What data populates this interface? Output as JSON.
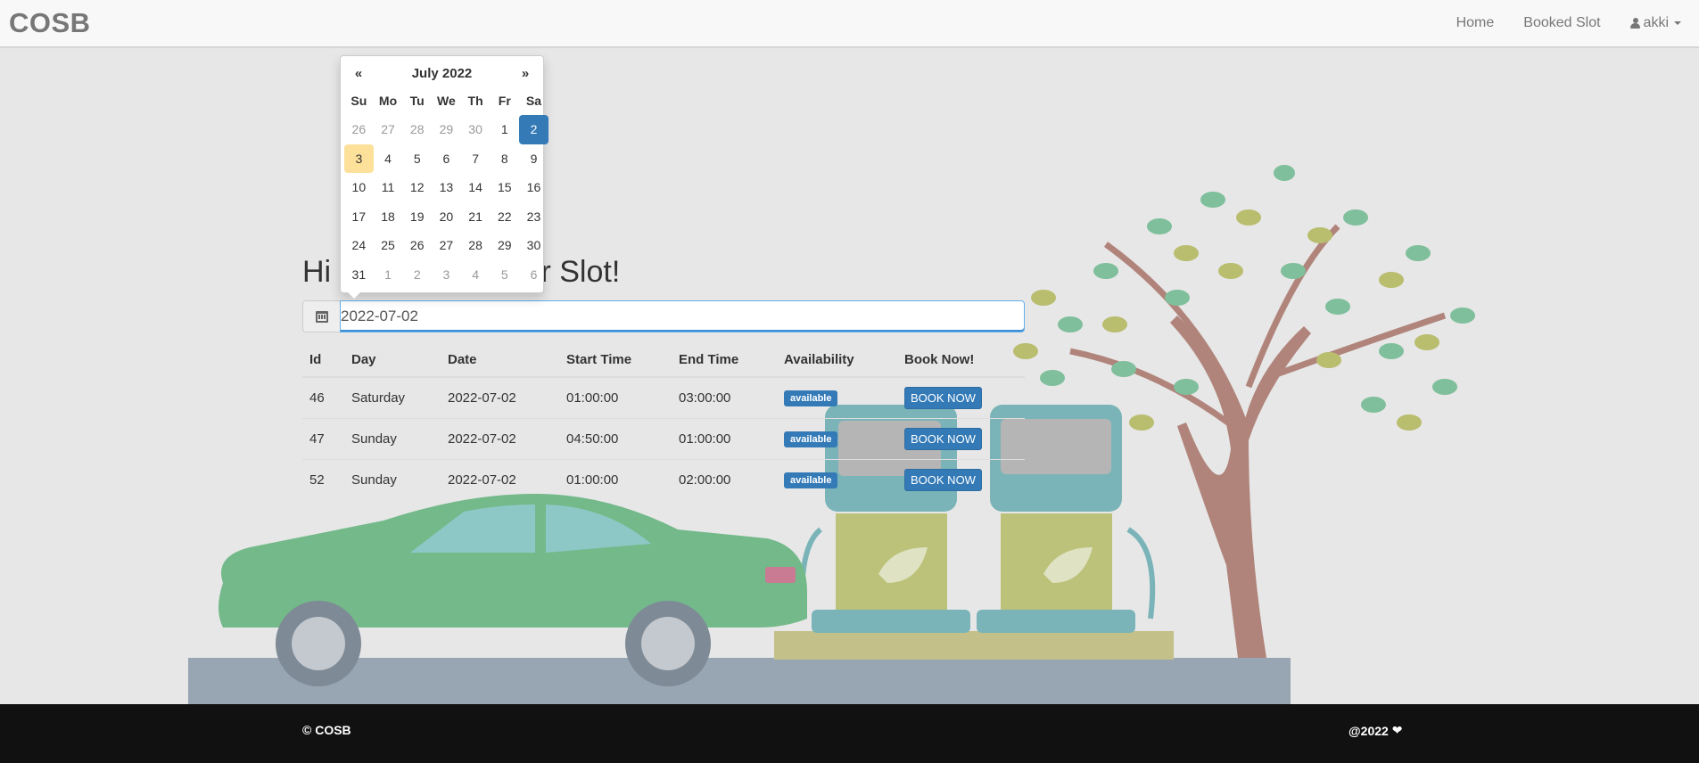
{
  "navbar": {
    "brand": "COSB",
    "links": [
      {
        "label": "Home"
      },
      {
        "label": "Booked Slot"
      }
    ],
    "user": {
      "label": "akki",
      "icon": "user-icon"
    }
  },
  "main": {
    "heading_left": "Hi a",
    "heading_right": "r Slot!",
    "date_input": {
      "value": "2022-07-02",
      "icon": "calendar-icon"
    }
  },
  "datepicker": {
    "prev": "«",
    "title": "July 2022",
    "next": "»",
    "dow": [
      "Su",
      "Mo",
      "Tu",
      "We",
      "Th",
      "Fr",
      "Sa"
    ],
    "days": [
      {
        "d": "26",
        "cls": "old"
      },
      {
        "d": "27",
        "cls": "old"
      },
      {
        "d": "28",
        "cls": "old"
      },
      {
        "d": "29",
        "cls": "old"
      },
      {
        "d": "30",
        "cls": "old"
      },
      {
        "d": "1",
        "cls": ""
      },
      {
        "d": "2",
        "cls": "active"
      },
      {
        "d": "3",
        "cls": "today"
      },
      {
        "d": "4",
        "cls": ""
      },
      {
        "d": "5",
        "cls": ""
      },
      {
        "d": "6",
        "cls": ""
      },
      {
        "d": "7",
        "cls": ""
      },
      {
        "d": "8",
        "cls": ""
      },
      {
        "d": "9",
        "cls": ""
      },
      {
        "d": "10",
        "cls": ""
      },
      {
        "d": "11",
        "cls": ""
      },
      {
        "d": "12",
        "cls": ""
      },
      {
        "d": "13",
        "cls": ""
      },
      {
        "d": "14",
        "cls": ""
      },
      {
        "d": "15",
        "cls": ""
      },
      {
        "d": "16",
        "cls": ""
      },
      {
        "d": "17",
        "cls": ""
      },
      {
        "d": "18",
        "cls": ""
      },
      {
        "d": "19",
        "cls": ""
      },
      {
        "d": "20",
        "cls": ""
      },
      {
        "d": "21",
        "cls": ""
      },
      {
        "d": "22",
        "cls": ""
      },
      {
        "d": "23",
        "cls": ""
      },
      {
        "d": "24",
        "cls": ""
      },
      {
        "d": "25",
        "cls": ""
      },
      {
        "d": "26",
        "cls": ""
      },
      {
        "d": "27",
        "cls": ""
      },
      {
        "d": "28",
        "cls": ""
      },
      {
        "d": "29",
        "cls": ""
      },
      {
        "d": "30",
        "cls": ""
      },
      {
        "d": "31",
        "cls": ""
      },
      {
        "d": "1",
        "cls": "old"
      },
      {
        "d": "2",
        "cls": "old"
      },
      {
        "d": "3",
        "cls": "old"
      },
      {
        "d": "4",
        "cls": "old"
      },
      {
        "d": "5",
        "cls": "old"
      },
      {
        "d": "6",
        "cls": "old"
      }
    ]
  },
  "table": {
    "headers": [
      "Id",
      "Day",
      "Date",
      "Start Time",
      "End Time",
      "Availability",
      "Book Now!"
    ],
    "rows": [
      {
        "id": "46",
        "day": "Saturday",
        "date": "2022-07-02",
        "start": "01:00:00",
        "end": "03:00:00",
        "availability": "available",
        "action": "BOOK NOW"
      },
      {
        "id": "47",
        "day": "Sunday",
        "date": "2022-07-02",
        "start": "04:50:00",
        "end": "01:00:00",
        "availability": "available",
        "action": "BOOK NOW"
      },
      {
        "id": "52",
        "day": "Sunday",
        "date": "2022-07-02",
        "start": "01:00:00",
        "end": "02:00:00",
        "availability": "available",
        "action": "BOOK NOW"
      }
    ]
  },
  "footer": {
    "left": "© COSB",
    "right": "@2022",
    "heart_icon": "heart-icon"
  },
  "colors": {
    "primary": "#337ab7",
    "today": "#fde19a",
    "footer_bg": "#111111",
    "navbar_bg": "#f8f8f8",
    "page_bg": "#e7e7e7"
  }
}
